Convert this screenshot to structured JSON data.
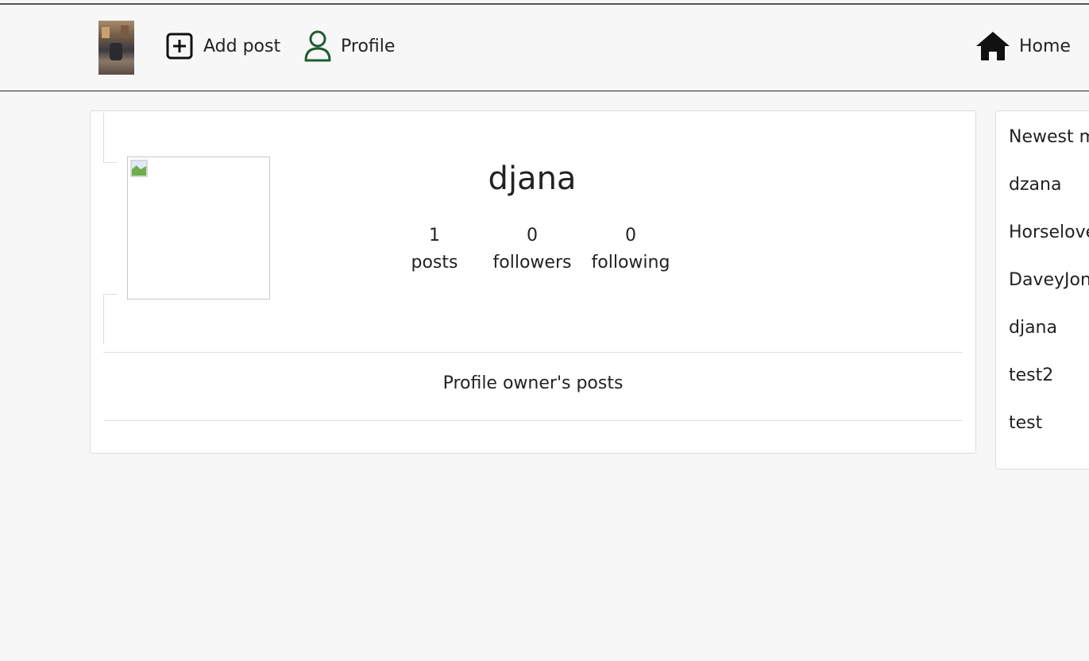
{
  "navbar": {
    "logo_alt": "site logo",
    "add_post_label": "Add post",
    "profile_label": "Profile",
    "home_label": "Home"
  },
  "profile": {
    "username": "djana",
    "posts_count": "1",
    "posts_label": "posts",
    "followers_count": "0",
    "followers_label": "followers",
    "following_count": "0",
    "following_label": "following",
    "posts_heading": "Profile owner's posts"
  },
  "sidebar": {
    "title": "Newest members",
    "items": [
      {
        "label": "dzana"
      },
      {
        "label": "Horselover"
      },
      {
        "label": "DaveyJones"
      },
      {
        "label": "djana"
      },
      {
        "label": "test2"
      },
      {
        "label": "test"
      }
    ]
  },
  "colors": {
    "profile_icon": "#1f5c2e",
    "background": "#f7f7f7"
  }
}
